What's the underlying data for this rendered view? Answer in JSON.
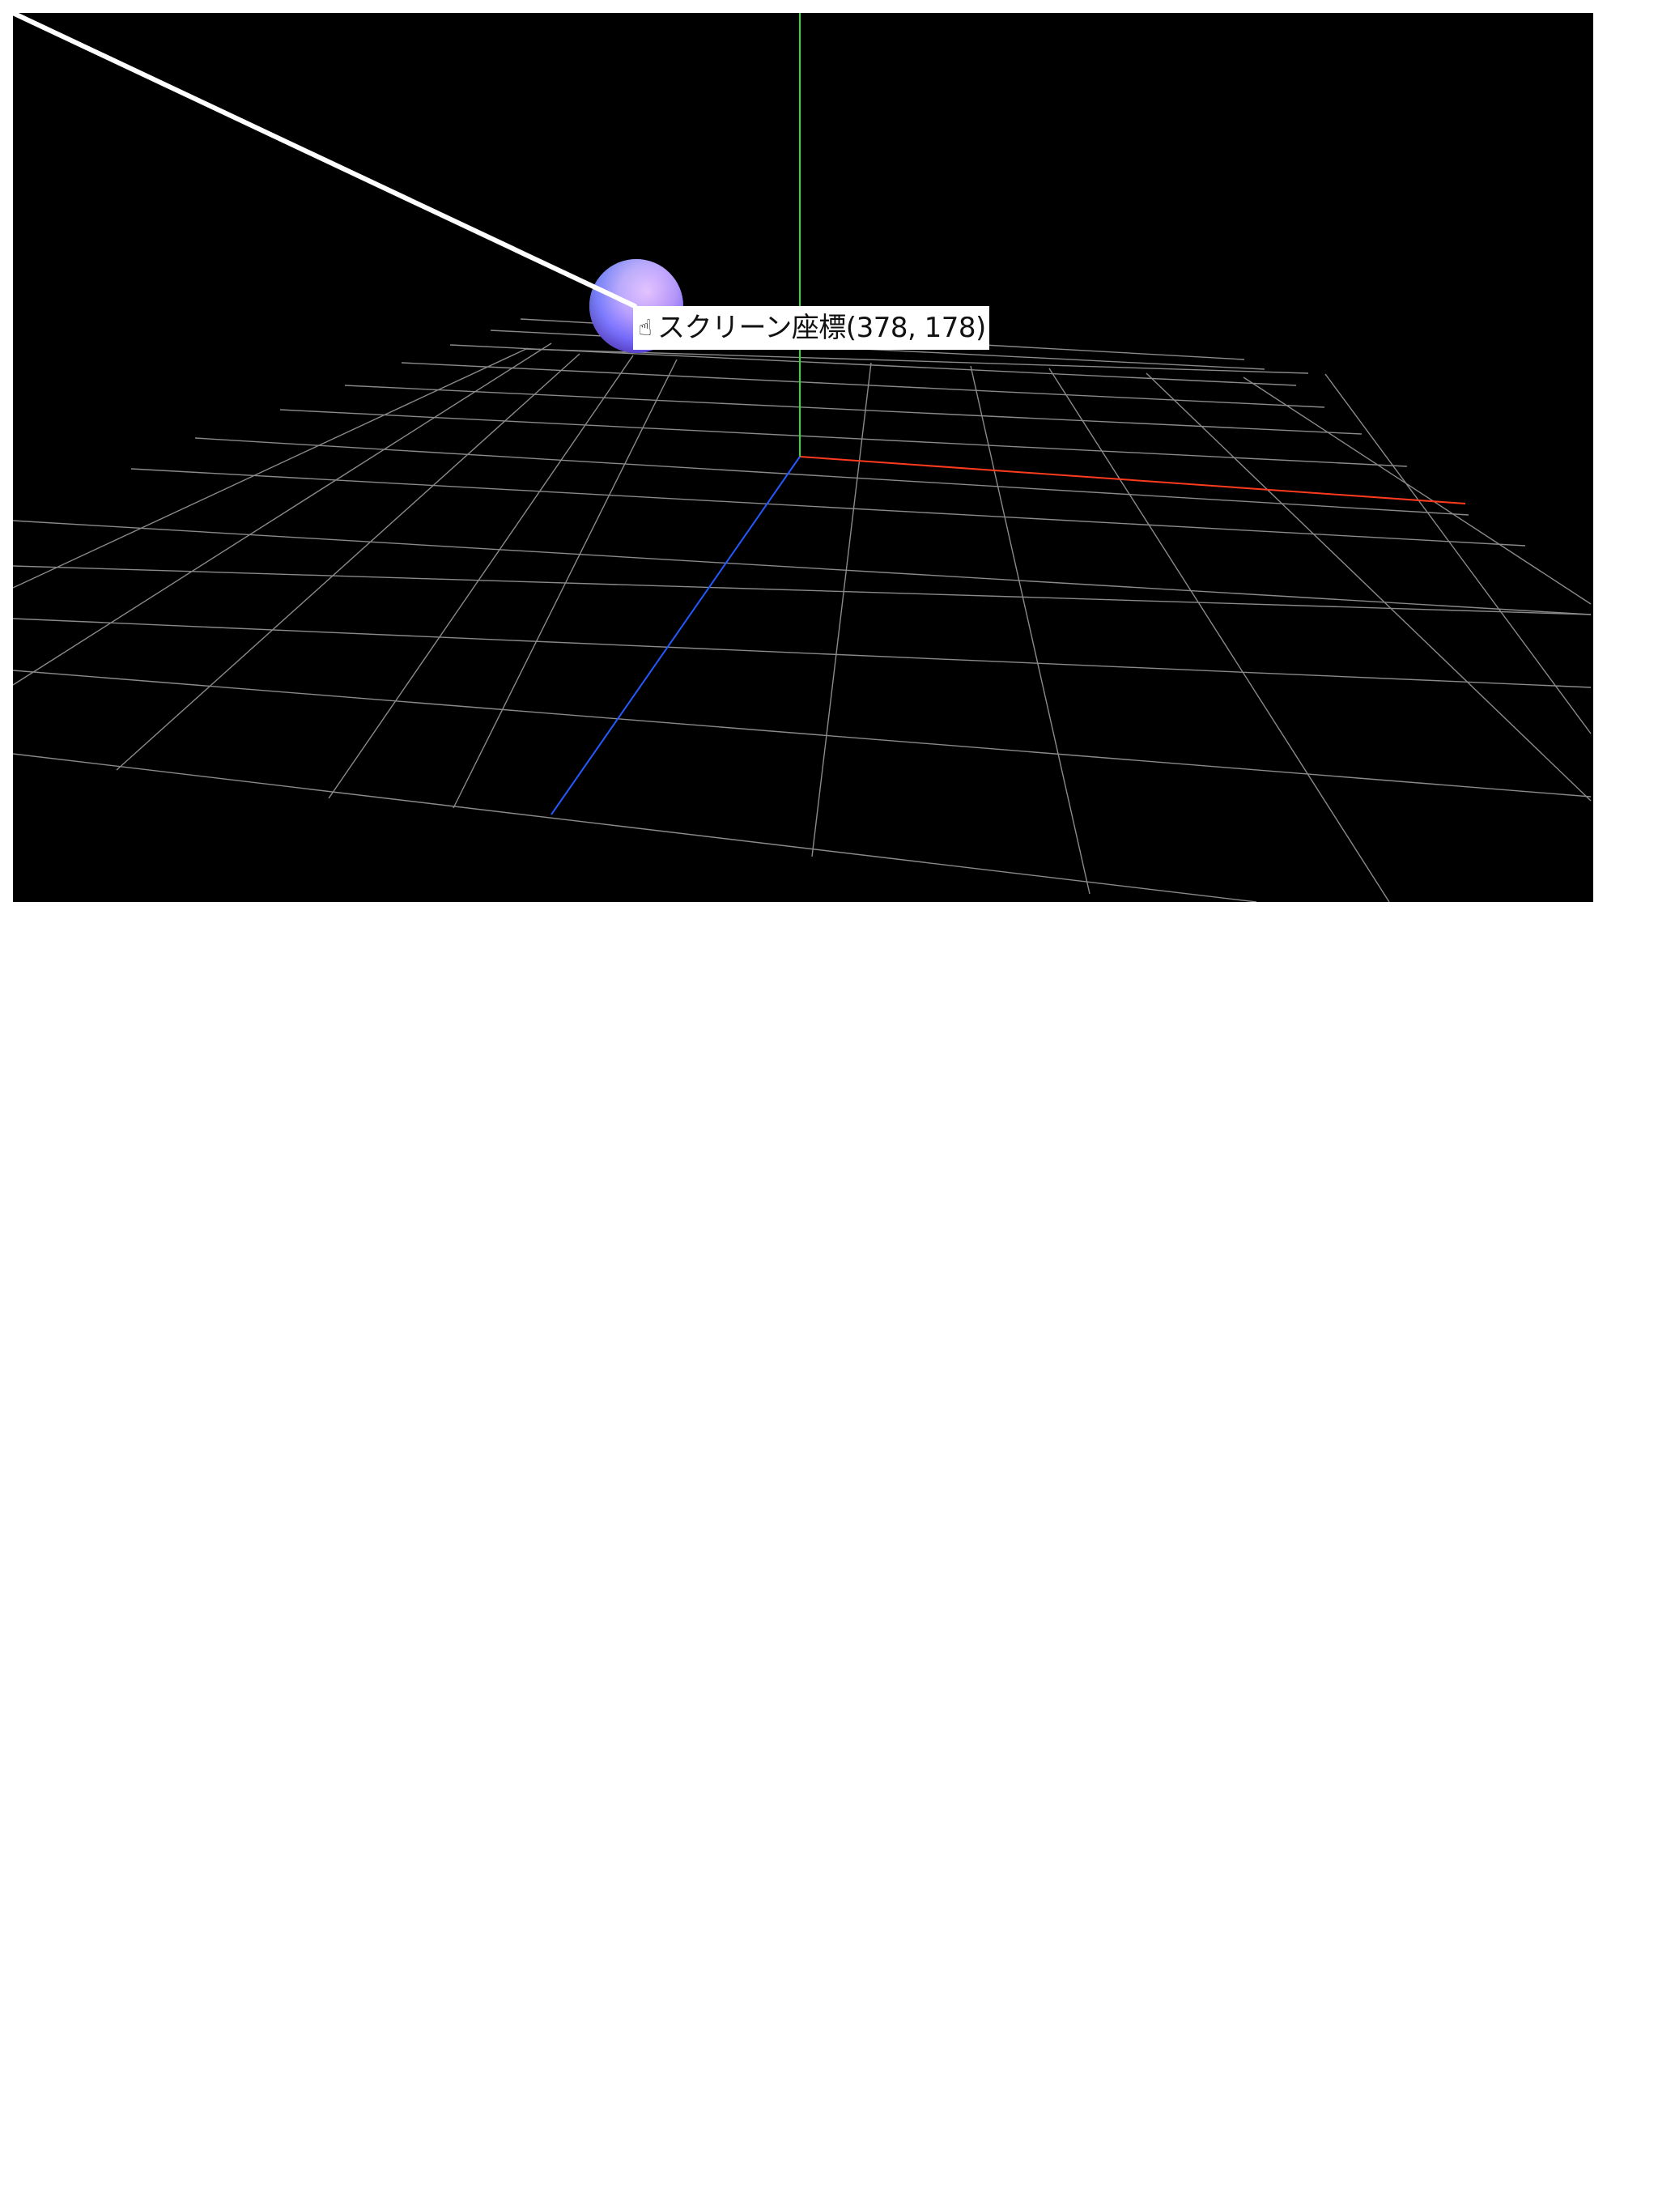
{
  "viewport": {
    "background": "#000000",
    "icons": {
      "pointer": "pointing-hand-icon"
    }
  },
  "label": {
    "text": "スクリーン座標(378, 178)"
  },
  "colors": {
    "grid": "#8a8a8a",
    "x_axis": "#ff3b1f",
    "y_axis": "#35d82c",
    "z_axis": "#2459ff",
    "ray": "#ffffff"
  }
}
